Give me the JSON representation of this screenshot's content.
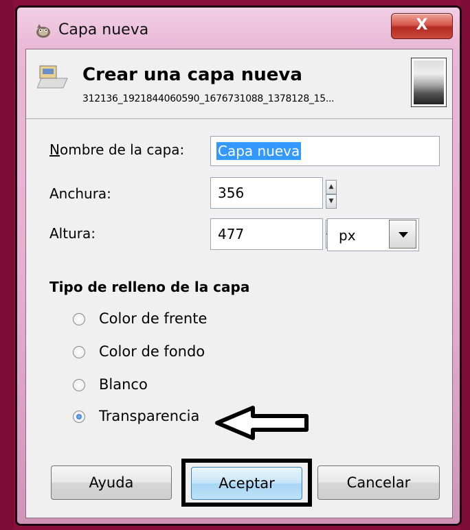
{
  "window": {
    "title": "Capa nueva",
    "close_label": "X"
  },
  "header": {
    "title": "Crear una capa nueva",
    "subtitle": "312136_1921844060590_1676731088_1378128_15..."
  },
  "form": {
    "name_label": "Nombre de la capa:",
    "name_value": "Capa nueva",
    "width_label": "Anchura:",
    "width_value": "356",
    "height_label": "Altura:",
    "height_value": "477",
    "unit_value": "px"
  },
  "fill": {
    "title": "Tipo de relleno de la capa",
    "options": [
      {
        "label": "Color de frente",
        "selected": false
      },
      {
        "label": "Color de fondo",
        "selected": false
      },
      {
        "label": "Blanco",
        "selected": false
      },
      {
        "label": "Transparencia",
        "selected": true
      }
    ]
  },
  "buttons": {
    "help": "Ayuda",
    "ok": "Aceptar",
    "cancel": "Cancelar"
  },
  "colors": {
    "desktop": "#8a0f3c",
    "selection": "#3399ff"
  }
}
